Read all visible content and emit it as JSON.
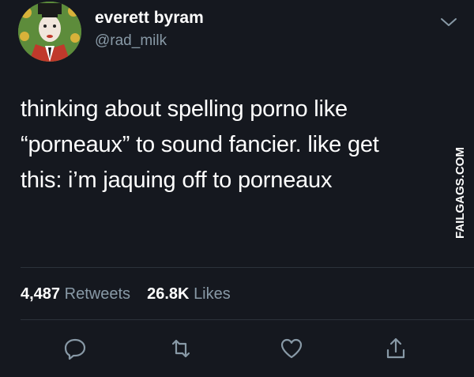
{
  "user": {
    "display_name": "everett byram",
    "handle": "@rad_milk"
  },
  "tweet": {
    "lines": [
      "thinking about spelling porno like",
      "“porneaux” to sound fancier. like get",
      "this: i’m jaquing off to porneaux"
    ]
  },
  "stats": {
    "retweets_count": "4,487",
    "retweets_label": "Retweets",
    "likes_count": "26.8K",
    "likes_label": "Likes"
  },
  "watermark": "FAILGAGS.COM",
  "icons": {
    "caret": "chevron-down-icon",
    "reply": "reply-icon",
    "retweet": "retweet-icon",
    "like": "heart-icon",
    "share": "share-icon"
  },
  "colors": {
    "background": "#15181f",
    "text_primary": "#ffffff",
    "text_secondary": "#8899a6",
    "divider": "#2c323b",
    "icon": "#8899a6"
  }
}
